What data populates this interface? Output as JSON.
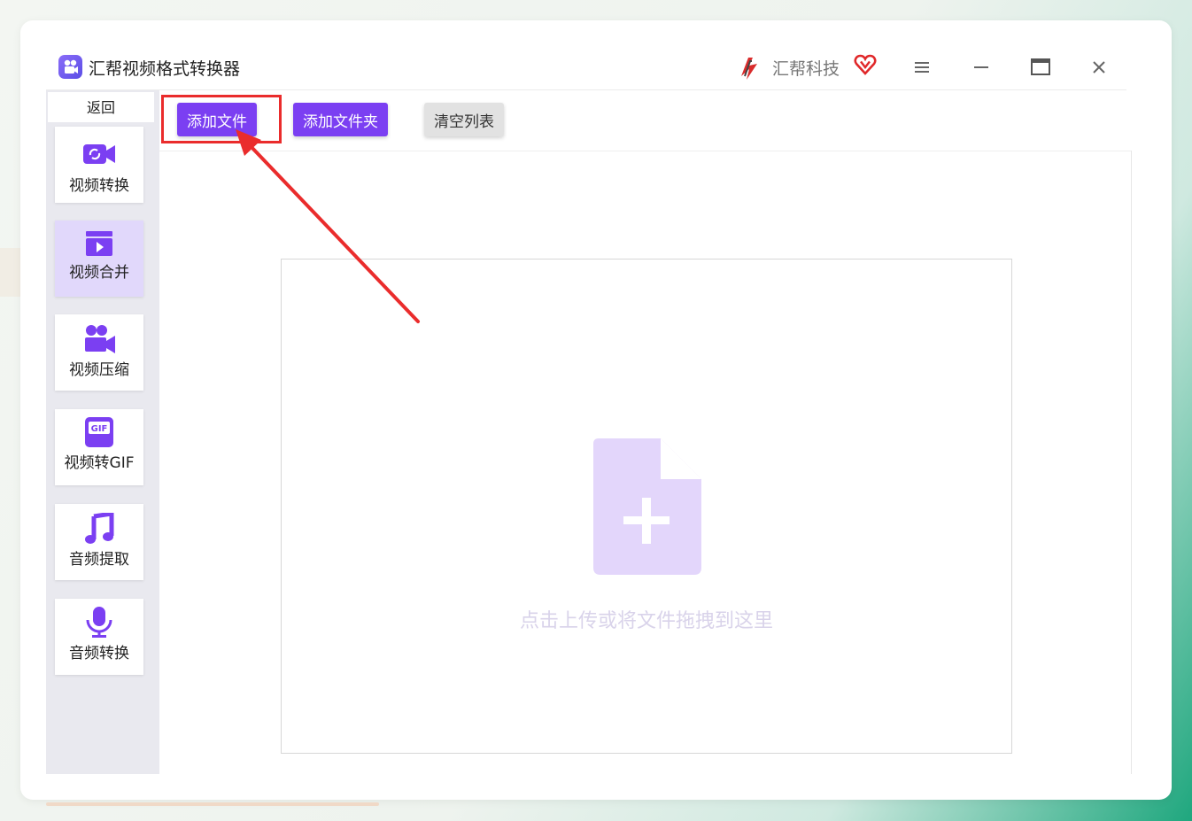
{
  "app": {
    "title": "汇帮视频格式转换器",
    "brand": "汇帮科技"
  },
  "sidebar": {
    "back_label": "返回",
    "items": [
      {
        "label": "视频转换",
        "icon": "video-convert-icon",
        "active": false
      },
      {
        "label": "视频合并",
        "icon": "video-merge-icon",
        "active": true
      },
      {
        "label": "视频压缩",
        "icon": "video-compress-icon",
        "active": false
      },
      {
        "label": "视频转GIF",
        "icon": "gif-icon",
        "active": false
      },
      {
        "label": "音频提取",
        "icon": "music-note-icon",
        "active": false
      },
      {
        "label": "音频转换",
        "icon": "microphone-icon",
        "active": false
      }
    ]
  },
  "toolbar": {
    "add_file": "添加文件",
    "add_folder": "添加文件夹",
    "clear_list": "清空列表"
  },
  "dropzone": {
    "hint": "点击上传或将文件拖拽到这里",
    "icon": "file-add-icon"
  },
  "colors": {
    "accent": "#7b3ff2",
    "active_nav": "#e1d8fb",
    "annotation": "#ea2c2c"
  }
}
